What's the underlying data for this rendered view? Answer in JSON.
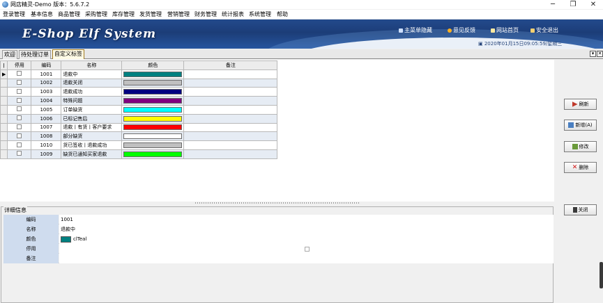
{
  "window": {
    "title": "网店精灵-Demo  版本：5.6.7.2",
    "controls": {
      "minimize": "─",
      "maximize": "❐",
      "close": "✕"
    }
  },
  "menu": [
    "登录管理",
    "基本信息",
    "商品管理",
    "采购管理",
    "库存管理",
    "发货管理",
    "营销管理",
    "财务管理",
    "统计报表",
    "系统管理",
    "帮助"
  ],
  "banner": {
    "brand": "E-Shop Elf System",
    "nav": [
      "主菜单隐藏",
      "意见反馈",
      "网站首页",
      "安全退出"
    ],
    "datetime": "2020年01月15日09:05:59/星期三"
  },
  "tabs": [
    "欢迎",
    "待处理订单",
    "自定义标签"
  ],
  "active_tab": "自定义标签",
  "grid": {
    "columns": [
      "停用",
      "编码",
      "名称",
      "颜色",
      "备注"
    ],
    "rows": [
      {
        "code": "1001",
        "name": "退款中",
        "color": "#008080",
        "note": ""
      },
      {
        "code": "1002",
        "name": "退款关闭",
        "color": "#c0c0c0",
        "note": ""
      },
      {
        "code": "1003",
        "name": "退款成功",
        "color": "#000080",
        "note": ""
      },
      {
        "code": "1004",
        "name": "特殊问题",
        "color": "#800080",
        "note": ""
      },
      {
        "code": "1005",
        "name": "订单缺货",
        "color": "#00ffff",
        "note": ""
      },
      {
        "code": "1006",
        "name": "已标记售后",
        "color": "#ffff00",
        "note": ""
      },
      {
        "code": "1007",
        "name": "退款丨有货丨客户要求",
        "color": "#ff0000",
        "note": ""
      },
      {
        "code": "1008",
        "name": "部分缺货",
        "color": "#ffffff",
        "note": ""
      },
      {
        "code": "1010",
        "name": "货已签收丨退款成功",
        "color": "#c0c0c0",
        "note": ""
      },
      {
        "code": "1009",
        "name": "缺货已通知买家退款",
        "color": "#00ff00",
        "note": ""
      }
    ]
  },
  "buttons": {
    "refresh": "刷新",
    "add": "新增(A)",
    "edit": "修改",
    "delete": "删除",
    "close": "关闭"
  },
  "detail": {
    "legend": "详细信息",
    "labels": {
      "code": "编码",
      "name": "名称",
      "color": "颜色",
      "disabled": "停用",
      "note": "备注"
    },
    "values": {
      "code": "1001",
      "name": "退款中",
      "color_name": "clTeal",
      "color_hex": "#008080",
      "note": ""
    }
  }
}
